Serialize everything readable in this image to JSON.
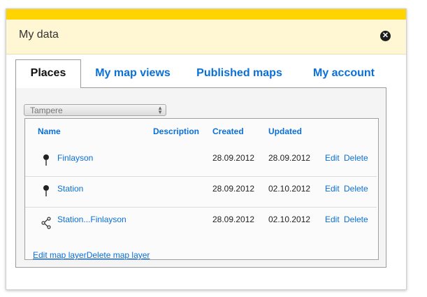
{
  "dialog": {
    "title": "My data",
    "close_icon": "close-icon"
  },
  "tabs": [
    {
      "label": "Places",
      "active": true
    },
    {
      "label": "My map views",
      "active": false
    },
    {
      "label": "Published maps",
      "active": false
    },
    {
      "label": "My account",
      "active": false
    }
  ],
  "layer_select": {
    "value": "Tampere"
  },
  "table": {
    "columns": [
      "Name",
      "Description",
      "Created",
      "Updated"
    ],
    "rows": [
      {
        "icon": "pin-icon",
        "name": "Finlayson",
        "description": "",
        "created": "28.09.2012",
        "updated": "28.09.2012",
        "edit": "Edit",
        "delete": "Delete"
      },
      {
        "icon": "pin-icon",
        "name": "Station",
        "description": "",
        "created": "28.09.2012",
        "updated": "02.10.2012",
        "edit": "Edit",
        "delete": "Delete"
      },
      {
        "icon": "share-route-icon",
        "name": "Station...Finlayson",
        "description": "",
        "created": "28.09.2012",
        "updated": "02.10.2012",
        "edit": "Edit",
        "delete": "Delete"
      }
    ]
  },
  "footer": {
    "edit_layer": "Edit map layer",
    "delete_layer": "Delete map layer"
  },
  "colors": {
    "accent_yellow": "#ffd400",
    "header_bg": "#fff6d3",
    "link_blue": "#0a6fd6"
  }
}
